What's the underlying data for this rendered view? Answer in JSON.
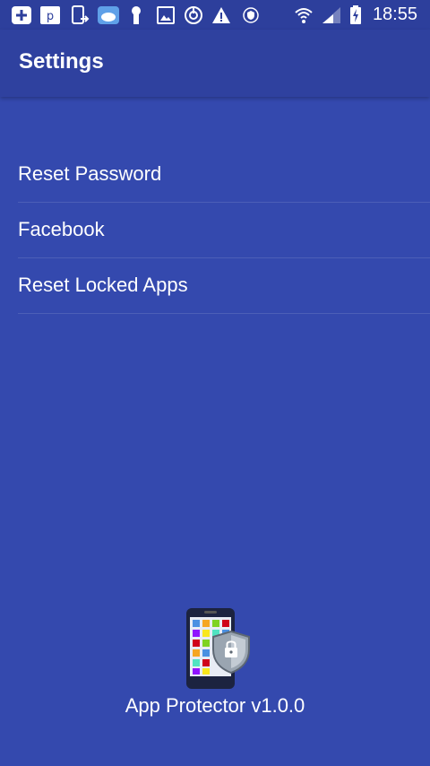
{
  "status_bar": {
    "time": "18:55",
    "icons": [
      "add-box-icon",
      "p-app-icon",
      "phone-arrow-icon",
      "cloud-app-icon",
      "keyhole-icon",
      "image-icon",
      "power-icon",
      "warning-icon",
      "shield-small-icon",
      "wifi-icon",
      "signal-icon",
      "battery-charging-icon"
    ]
  },
  "app_bar": {
    "title": "Settings"
  },
  "menu": {
    "items": [
      {
        "label": "Reset Password"
      },
      {
        "label": "Facebook"
      },
      {
        "label": "Reset Locked Apps"
      }
    ]
  },
  "footer": {
    "app_name": "App Protector v1.0.0",
    "logo_icon": "phone-lock-shield-icon"
  },
  "colors": {
    "background": "#3449ae",
    "app_bar": "#2f419f",
    "status_bar": "#2d3f9c",
    "text": "#ffffff"
  }
}
